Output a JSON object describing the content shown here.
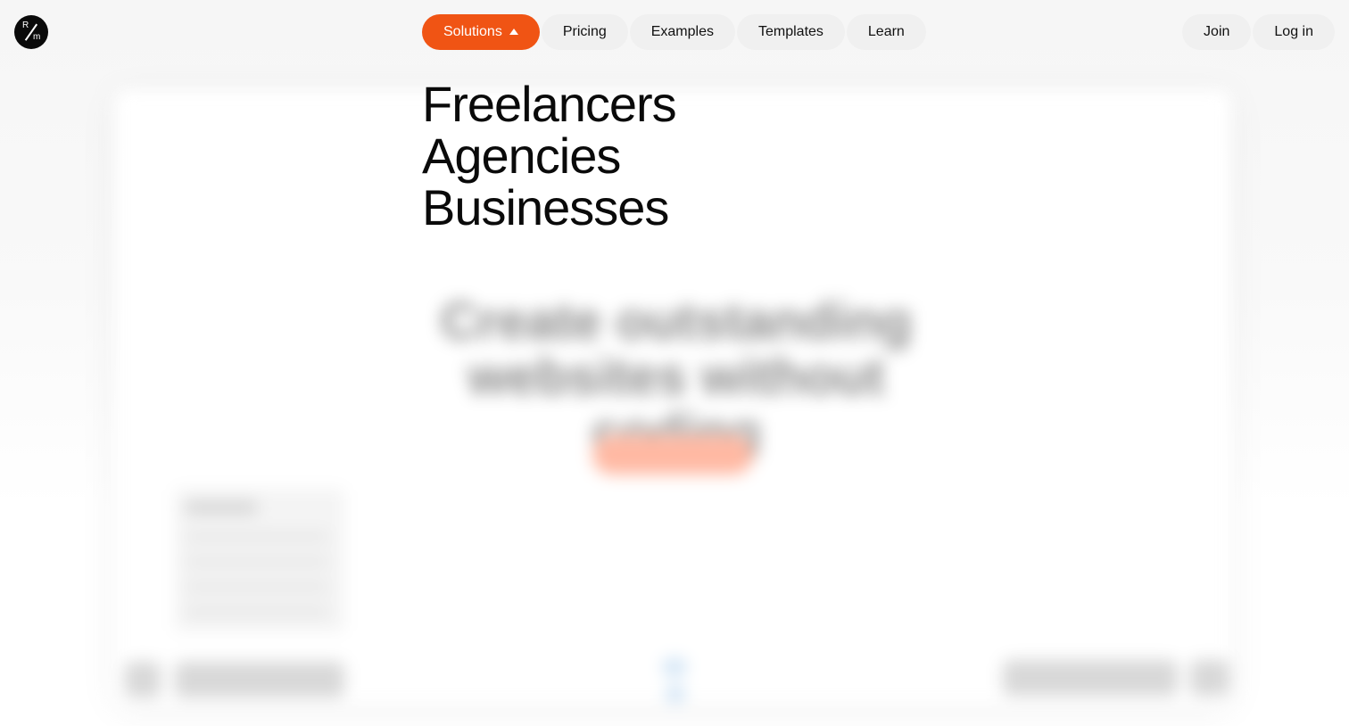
{
  "logo": {
    "top_letter": "R",
    "bottom_letter": "m",
    "icon": "logo-mark"
  },
  "nav": {
    "solutions": {
      "label": "Solutions",
      "icon": "caret-up-icon",
      "active": true
    },
    "pricing": "Pricing",
    "examples": "Examples",
    "templates": "Templates",
    "learn": "Learn",
    "join": "Join",
    "login": "Log in"
  },
  "solutions_menu": {
    "items": [
      "Freelancers",
      "Agencies",
      "Businesses"
    ]
  },
  "background_preview": {
    "headline": "Create outstanding websites without coding"
  },
  "colors": {
    "accent": "#f05414",
    "pill_bg": "#f0f0f0",
    "text": "#0a0a0a"
  }
}
